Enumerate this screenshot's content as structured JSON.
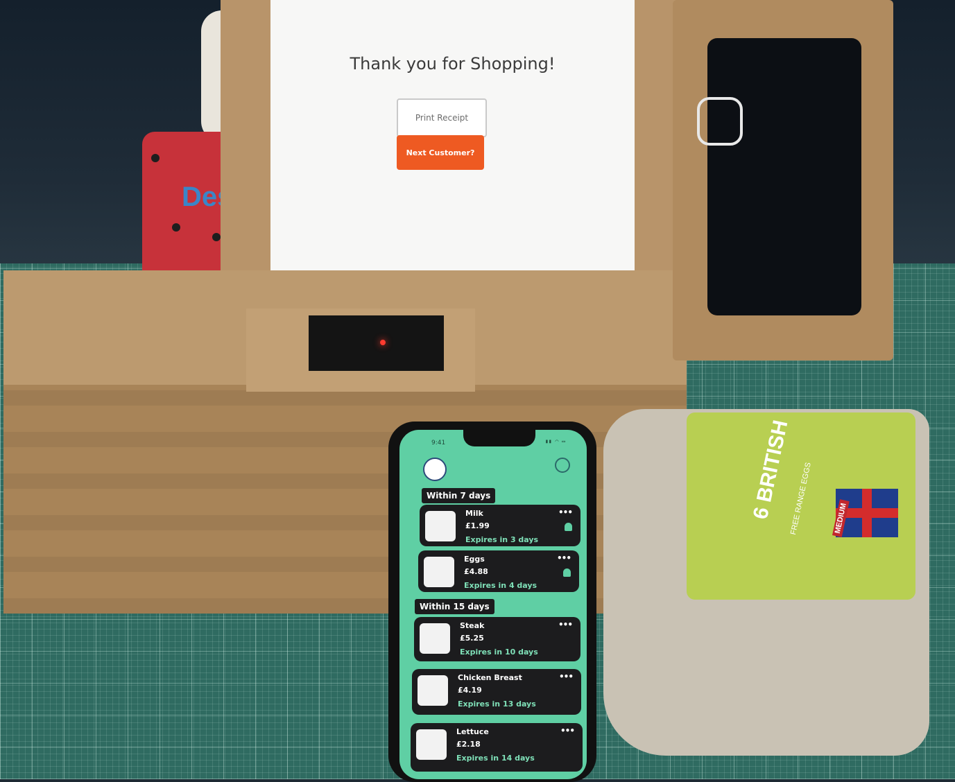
{
  "kiosk": {
    "heading": "Thank you for Shopping!",
    "print_receipt_label": "Print Receipt",
    "next_customer_label": "Next Customer?"
  },
  "dispenser": {
    "text": "Des"
  },
  "phone": {
    "time": "9:41",
    "sections": [
      {
        "title": "Within 7 days",
        "items": [
          {
            "name": "Milk",
            "price": "£1.99",
            "expiry": "Expires in 3 days",
            "bell": true
          },
          {
            "name": "Eggs",
            "price": "£4.88",
            "expiry": "Expires in 4 days",
            "bell": true
          }
        ]
      },
      {
        "title": "Within 15 days",
        "items": [
          {
            "name": "Steak",
            "price": "£5.25",
            "expiry": "Expires in 10 days",
            "bell": false
          },
          {
            "name": "Chicken Breast",
            "price": "£4.19",
            "expiry": "Expires in 13 days",
            "bell": false
          },
          {
            "name": "Lettuce",
            "price": "£2.18",
            "expiry": "Expires in 14 days",
            "bell": false
          }
        ]
      }
    ],
    "more_glyph": "•••"
  },
  "egg_carton": {
    "title": "6 BRITISH",
    "subtitle": "FREE RANGE EGGS",
    "size": "MEDIUM"
  },
  "colors": {
    "accent_orange": "#ee5a22",
    "app_green": "#5fcfa4",
    "card_dark": "#1c1c1e",
    "cardboard": "#b8946a",
    "cutting_mat": "#2f6b61"
  }
}
